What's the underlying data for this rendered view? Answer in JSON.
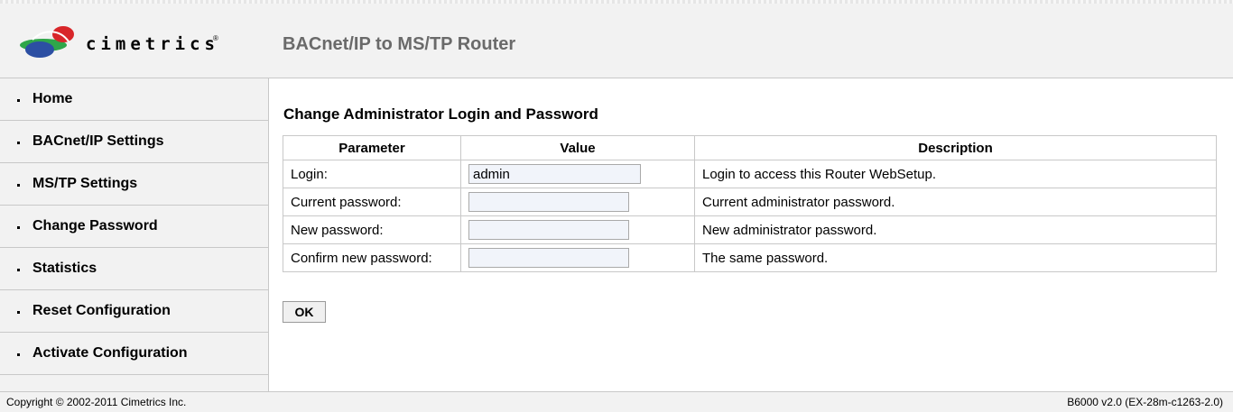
{
  "header": {
    "logo_text": "cimetrics",
    "logo_tm": "®",
    "title": "BACnet/IP to MS/TP Router"
  },
  "sidebar": {
    "items": [
      {
        "label": "Home"
      },
      {
        "label": "BACnet/IP Settings"
      },
      {
        "label": "MS/TP Settings"
      },
      {
        "label": "Change Password"
      },
      {
        "label": "Statistics"
      },
      {
        "label": "Reset Configuration"
      },
      {
        "label": "Activate Configuration"
      }
    ]
  },
  "main": {
    "title": "Change Administrator Login and Password",
    "table": {
      "headers": [
        "Parameter",
        "Value",
        "Description"
      ],
      "rows": [
        {
          "parameter": "Login:",
          "value": "admin",
          "description": "Login to access this Router WebSetup."
        },
        {
          "parameter": "Current password:",
          "value": "",
          "description": "Current administrator password."
        },
        {
          "parameter": "New password:",
          "value": "",
          "description": "New administrator password."
        },
        {
          "parameter": "Confirm new password:",
          "value": "",
          "description": "The same password."
        }
      ]
    },
    "ok_label": "OK"
  },
  "footer": {
    "copyright": "Copyright © 2002-2011 Cimetrics Inc.",
    "version": "B6000 v2.0 (EX-28m-c1263-2.0)"
  },
  "colors": {
    "background": "#f2f2f2",
    "title_gray": "#6a6a6a",
    "input_bg": "#f1f4fa",
    "logo_green": "#2fa64a",
    "logo_blue": "#2c4fa3",
    "logo_red": "#d8262a"
  }
}
